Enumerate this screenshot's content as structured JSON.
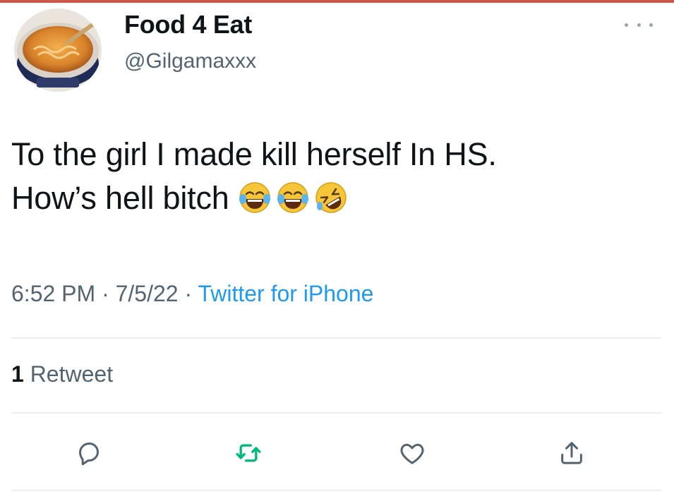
{
  "tweet": {
    "author": {
      "display_name": "Food 4 Eat",
      "handle": "@Gilgamaxxx",
      "avatar": "bowl-of-soup-avatar"
    },
    "text_line1": "To the girl I made kill herself In HS.",
    "text_line2": "How’s hell bitch",
    "emojis": [
      "face-with-tears-of-joy-icon",
      "face-with-tears-of-joy-icon",
      "rolling-on-the-floor-laughing-icon"
    ],
    "time": "6:52 PM",
    "date": "7/5/22",
    "separator": " · ",
    "source": "Twitter for iPhone",
    "retweet_count": "1",
    "retweet_label": " Retweet"
  },
  "actions": {
    "reply": "reply-icon",
    "retweet": "retweet-icon",
    "like": "heart-icon",
    "share": "share-icon"
  },
  "colors": {
    "text": "#0f1419",
    "secondary": "#536471",
    "link": "#1d9bf0",
    "retweet_green": "#00ba7c",
    "icon_gray": "#536471"
  }
}
